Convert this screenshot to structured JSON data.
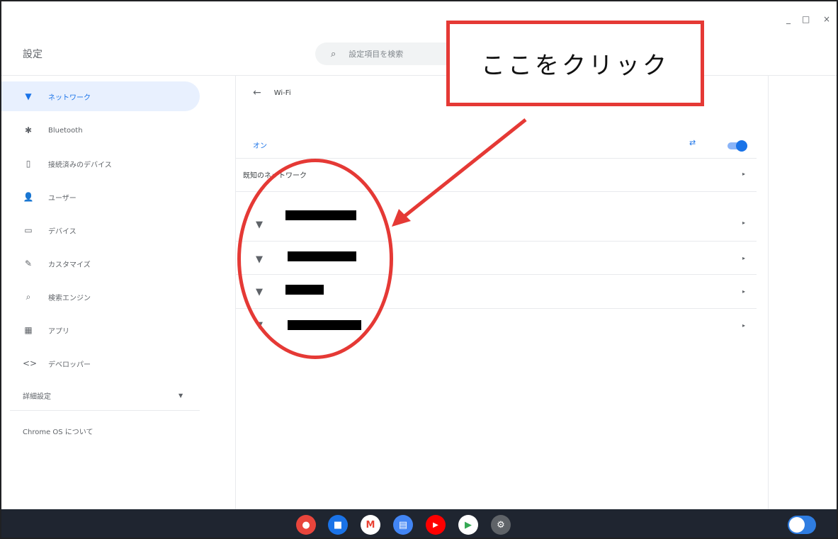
{
  "window": {
    "minimize_glyph": "_",
    "maximize_glyph": "□",
    "close_glyph": "×"
  },
  "header": {
    "title": "設定",
    "search_placeholder": "設定項目を検索"
  },
  "sidebar": {
    "items": [
      {
        "label": "ネットワーク",
        "icon": "wifi-icon",
        "glyph": "▼",
        "active": true
      },
      {
        "label": "Bluetooth",
        "icon": "bluetooth-icon",
        "glyph": "✱",
        "active": false
      },
      {
        "label": "接続済みのデバイス",
        "icon": "phone-icon",
        "glyph": "▯",
        "active": false
      },
      {
        "label": "ユーザー",
        "icon": "person-icon",
        "glyph": "👤",
        "active": false
      },
      {
        "label": "デバイス",
        "icon": "laptop-icon",
        "glyph": "▭",
        "active": false
      },
      {
        "label": "カスタマイズ",
        "icon": "brush-icon",
        "glyph": "✎",
        "active": false
      },
      {
        "label": "検索エンジン",
        "icon": "search-icon",
        "glyph": "⌕",
        "active": false
      },
      {
        "label": "アプリ",
        "icon": "apps-grid-icon",
        "glyph": "▦",
        "active": false
      },
      {
        "label": "デベロッパー",
        "icon": "code-icon",
        "glyph": "<>",
        "active": false
      }
    ],
    "advanced_label": "詳細設定",
    "about_label": "Chrome OS について"
  },
  "main": {
    "back_glyph": "←",
    "page_title": "Wi-Fi",
    "status_label": "オン",
    "toggle_on": true,
    "known_networks_label": "既知のネットワーク",
    "networks_count_note": ""
  },
  "annotation": {
    "callout_text": "ここをクリック"
  },
  "shelf": {
    "apps": [
      {
        "icon": "chrome-icon",
        "color": "#e8453c",
        "glyph": "●"
      },
      {
        "icon": "files-icon",
        "color": "#1a73e8",
        "glyph": "■"
      },
      {
        "icon": "gmail-icon",
        "color": "#ea4335",
        "glyph": "M"
      },
      {
        "icon": "docs-icon",
        "color": "#4285f4",
        "glyph": "▤"
      },
      {
        "icon": "youtube-icon",
        "color": "#ff0000",
        "glyph": "▶"
      },
      {
        "icon": "play-store-icon",
        "color": "#34a853",
        "glyph": "▶"
      },
      {
        "icon": "settings-gear-icon",
        "color": "#5f6368",
        "glyph": "⚙"
      }
    ]
  },
  "colors": {
    "accent": "#1a73e8",
    "annotation_red": "#e53935",
    "shelf_bg": "#1f2530"
  }
}
